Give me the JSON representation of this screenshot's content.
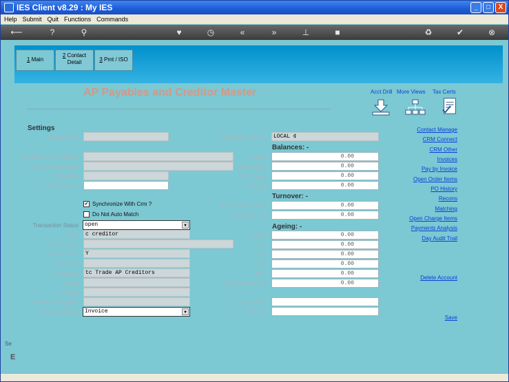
{
  "window": {
    "title": "IES Client v8.29 : My IES",
    "minimize": "_",
    "maximize": "□",
    "close": "X"
  },
  "menu": [
    "Help",
    "Submit",
    "Quit",
    "Functions",
    "Commands"
  ],
  "toolbar_icons": [
    "back-icon",
    "help-icon",
    "search-icon",
    "heart-icon",
    "clock-icon",
    "rewind-icon",
    "forward-icon",
    "pin-icon",
    "square-icon",
    "recycle-icon",
    "check-icon",
    "cancel-icon"
  ],
  "tabs": [
    {
      "num": "1",
      "label": "Main"
    },
    {
      "num": "2",
      "label": "Contact",
      "label2": "Detail"
    },
    {
      "num": "3",
      "label": "Pmt / ISO"
    }
  ],
  "form_title": "AP Payables and Creditor Master",
  "top_links": {
    "acct_drill": "Acct Drill",
    "more_views": "More Views",
    "tax_certs": "Tax Certs"
  },
  "settings": {
    "heading": "Settings",
    "account_key": {
      "label": "Account Key",
      "value": ""
    },
    "co_name": {
      "label": "*Co Name / Cust Name",
      "value": ""
    },
    "cheque_beneficiary": {
      "label": "Cheque Beneficiary",
      "value": ""
    },
    "client_ref": {
      "label": "Client Ref",
      "value": ""
    },
    "crm_number": {
      "label": "CRM Number",
      "value": ""
    },
    "sync_crm": {
      "label": "Synchronize With Crm ?",
      "checked": "✔"
    },
    "no_auto_match": {
      "label": "Do Not Auto Match",
      "checked": ""
    },
    "transaction_status": {
      "label": "Transaction Status",
      "value": "open"
    },
    "type": {
      "label": "Type",
      "value": "c creditor"
    },
    "control_acct": {
      "label": "Control Acct",
      "value": ""
    },
    "open_item": {
      "label": "Open Item?",
      "value": "Y"
    },
    "fin_limit": {
      "label": "Fin Limit",
      "value": ""
    },
    "category": {
      "label": "Category",
      "value": "tc Trade AP Creditors"
    },
    "group": {
      "label": "Group",
      "value": ""
    },
    "rating": {
      "label": "Rating",
      "value": ""
    },
    "tax_reg": {
      "label": "Tax Reg # Supplier",
      "value": ""
    },
    "payment_type": {
      "label": "Payment Type",
      "value": "Invoice"
    }
  },
  "managed_currency": {
    "label": "Managed Currency",
    "value": "LOCAL ¢"
  },
  "balances": {
    "heading": "Balances: -",
    "rows": [
      {
        "label": "Current",
        "value": "0.00"
      },
      {
        "label": "Year-to-Date",
        "value": "0.00"
      },
      {
        "label": "Qty Current",
        "value": "0.00"
      },
      {
        "label": "Qty Ytd",
        "value": "0.00"
      }
    ]
  },
  "turnover": {
    "heading": "Turnover: -",
    "rows": [
      {
        "label": "Purchases Current",
        "value": "0.00"
      },
      {
        "label": "Purchases YTD",
        "value": "0.00"
      }
    ]
  },
  "ageing": {
    "heading": "Ageing: -",
    "rows": [
      {
        "label": "Current",
        "value": "0.00"
      },
      {
        "label": "30+",
        "value": "0.00"
      },
      {
        "label": "60+",
        "value": "0.00"
      },
      {
        "label": "90+",
        "value": "0.00"
      },
      {
        "label": "120+",
        "value": "0.00"
      },
      {
        "label": "Unallocated Pmts",
        "value": "0.00"
      }
    ]
  },
  "last_upd_by": {
    "label": "Last Upd By",
    "value": ""
  },
  "last_upd": {
    "label": "Last Upd",
    "value": ""
  },
  "links": [
    "Contact Manage",
    "CRM Connect",
    "CRM Other",
    "Invoices",
    "Pay by Invoice",
    "Open Order Items",
    "PO History",
    "Recons",
    "Matching",
    "Open Charge Items",
    "Payments Analysis",
    "Day Audit Trail"
  ],
  "delete_link": "Delete Account",
  "save_link": "Save",
  "left_stub": {
    "top": "Se",
    "bottom": "E"
  },
  "colors": {
    "banner": "#0090cc",
    "content": "#7cc8d3",
    "link": "#0a3fd8",
    "title": "#d09a8a"
  }
}
